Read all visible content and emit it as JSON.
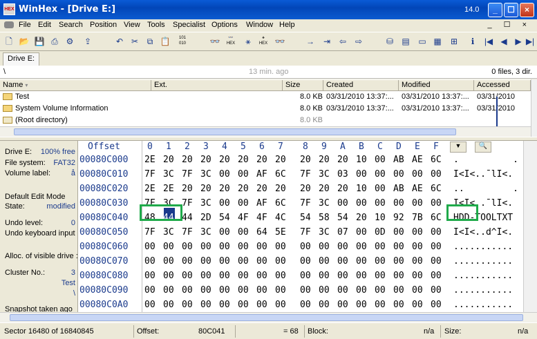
{
  "window": {
    "title": "WinHex - [Drive E:]",
    "version": "14.0",
    "app_icon_text": "HEX"
  },
  "menu": [
    "File",
    "Edit",
    "Search",
    "Position",
    "View",
    "Tools",
    "Specialist",
    "Options",
    "Window",
    "Help"
  ],
  "menu_right": "_ ☐ ×",
  "tabs": {
    "drive": "Drive E:"
  },
  "path": {
    "path": "\\",
    "time": "13 min. ago",
    "count": "0 files, 3 dir."
  },
  "filelist": {
    "headers": [
      "Name",
      "Ext.",
      "Size",
      "Created",
      "Modified",
      "Accessed"
    ],
    "rows": [
      {
        "name": "Test",
        "size": "8.0 KB",
        "created": "03/31/2010  13:37:...",
        "modified": "03/31/2010  13:37:...",
        "accessed": "03/31/2010"
      },
      {
        "name": "System Volume Information",
        "size": "8.0 KB",
        "created": "03/31/2010  13:37:...",
        "modified": "03/31/2010  13:37:...",
        "accessed": "03/31/2010"
      },
      {
        "name": "(Root directory)",
        "size": "8.0 KB",
        "created": "",
        "modified": "",
        "accessed": ""
      }
    ]
  },
  "info": {
    "drive_label": "Drive E:",
    "drive_val": "100% free",
    "fs_label": "File system:",
    "fs_val": "FAT32",
    "vol_label": "Volume label:",
    "vol_val": "å",
    "edit_mode_label": "Default Edit Mode",
    "state_label": "State:",
    "state_val": "modified",
    "undo_level_label": "Undo level:",
    "undo_level_val": "0",
    "undo_label": "Undo keyboard input",
    "alloc_label": "Alloc. of visible drive :",
    "cluster_label": "Cluster No.:",
    "cluster_val": "3",
    "cluster_name": "Test",
    "cluster_path": "\\",
    "snapshot_label": "Snapshot taken ago"
  },
  "hex": {
    "offset_header": "Offset",
    "columns": [
      "0",
      "1",
      "2",
      "3",
      "4",
      "5",
      "6",
      "7",
      "8",
      "9",
      "A",
      "B",
      "C",
      "D",
      "E",
      "F"
    ],
    "rows": [
      {
        "offset": "00080C000",
        "bytes": [
          "2E",
          "20",
          "20",
          "20",
          "20",
          "20",
          "20",
          "20",
          "20",
          "20",
          "20",
          "10",
          "00",
          "AB",
          "AE",
          "6C"
        ],
        "text": ".          ."
      },
      {
        "offset": "00080C010",
        "bytes": [
          "7F",
          "3C",
          "7F",
          "3C",
          "00",
          "00",
          "AF",
          "6C",
          "7F",
          "3C",
          "03",
          "00",
          "00",
          "00",
          "00",
          "00"
        ],
        "text": "I<I<..¯lI<."
      },
      {
        "offset": "00080C020",
        "bytes": [
          "2E",
          "2E",
          "20",
          "20",
          "20",
          "20",
          "20",
          "20",
          "20",
          "20",
          "20",
          "10",
          "00",
          "AB",
          "AE",
          "6C"
        ],
        "text": "..         ."
      },
      {
        "offset": "00080C030",
        "bytes": [
          "7F",
          "3C",
          "7F",
          "3C",
          "00",
          "00",
          "AF",
          "6C",
          "7F",
          "3C",
          "00",
          "00",
          "00",
          "00",
          "00",
          "00"
        ],
        "text": "I<I<..¯lI<."
      },
      {
        "offset": "00080C040",
        "bytes": [
          "48",
          "44",
          "44",
          "2D",
          "54",
          "4F",
          "4F",
          "4C",
          "54",
          "58",
          "54",
          "20",
          "10",
          "92",
          "7B",
          "6C"
        ],
        "text": "HDD-TOOLTXT"
      },
      {
        "offset": "00080C050",
        "bytes": [
          "7F",
          "3C",
          "7F",
          "3C",
          "00",
          "00",
          "64",
          "5E",
          "7F",
          "3C",
          "07",
          "00",
          "0D",
          "00",
          "00",
          "00"
        ],
        "text": "I<I<..d^I<."
      },
      {
        "offset": "00080C060",
        "bytes": [
          "00",
          "00",
          "00",
          "00",
          "00",
          "00",
          "00",
          "00",
          "00",
          "00",
          "00",
          "00",
          "00",
          "00",
          "00",
          "00"
        ],
        "text": "..........."
      },
      {
        "offset": "00080C070",
        "bytes": [
          "00",
          "00",
          "00",
          "00",
          "00",
          "00",
          "00",
          "00",
          "00",
          "00",
          "00",
          "00",
          "00",
          "00",
          "00",
          "00"
        ],
        "text": "..........."
      },
      {
        "offset": "00080C080",
        "bytes": [
          "00",
          "00",
          "00",
          "00",
          "00",
          "00",
          "00",
          "00",
          "00",
          "00",
          "00",
          "00",
          "00",
          "00",
          "00",
          "00"
        ],
        "text": "..........."
      },
      {
        "offset": "00080C090",
        "bytes": [
          "00",
          "00",
          "00",
          "00",
          "00",
          "00",
          "00",
          "00",
          "00",
          "00",
          "00",
          "00",
          "00",
          "00",
          "00",
          "00"
        ],
        "text": "..........."
      },
      {
        "offset": "00080C0A0",
        "bytes": [
          "00",
          "00",
          "00",
          "00",
          "00",
          "00",
          "00",
          "00",
          "00",
          "00",
          "00",
          "00",
          "00",
          "00",
          "00",
          "00"
        ],
        "text": "..........."
      }
    ]
  },
  "status": {
    "sector": "Sector 16480 of 16840845",
    "offset_label": "Offset:",
    "offset_val": "80C041",
    "eq": "= 68",
    "block_label": "Block:",
    "block_val": "n/a",
    "size_label": "Size:",
    "size_val": "n/a"
  },
  "colors": {
    "titlebar": "#0a5bd6",
    "highlight": "#1faa4a",
    "offset_text": "#1a3a8c"
  }
}
